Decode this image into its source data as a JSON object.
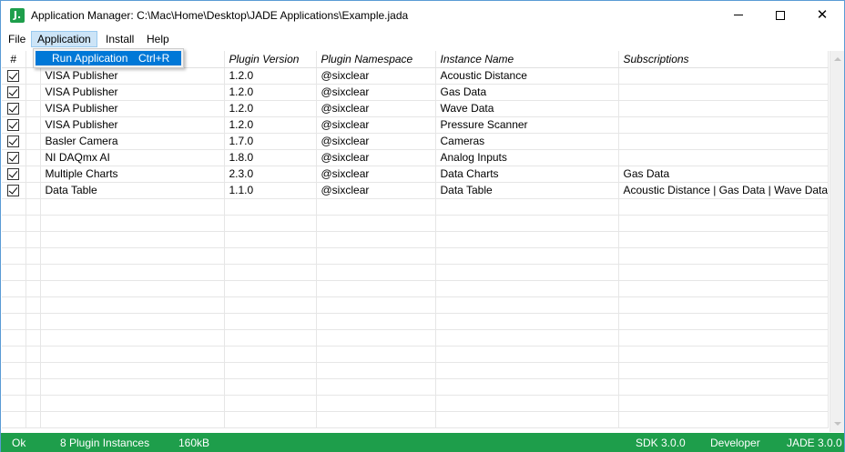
{
  "window": {
    "title": "Application Manager: C:\\Mac\\Home\\Desktop\\JADE Applications\\Example.jada",
    "icon_letter": "J.",
    "controls": {
      "minimize": "minimize-icon",
      "maximize": "maximize-icon",
      "close": "✕"
    }
  },
  "menubar": {
    "items": [
      {
        "label": "File"
      },
      {
        "label": "Application"
      },
      {
        "label": "Install"
      },
      {
        "label": "Help"
      }
    ]
  },
  "dropdown": {
    "item_label": "Run Application",
    "item_shortcut": "Ctrl+R"
  },
  "table": {
    "headers": [
      "#",
      "",
      "",
      "Plugin Version",
      "Plugin Namespace",
      "Instance Name",
      "Subscriptions"
    ],
    "rows": [
      {
        "checked": true,
        "plugin": "VISA Publisher",
        "version": "1.2.0",
        "namespace": "@sixclear",
        "instance": "Acoustic Distance",
        "subscriptions": ""
      },
      {
        "checked": true,
        "plugin": "VISA Publisher",
        "version": "1.2.0",
        "namespace": "@sixclear",
        "instance": "Gas Data",
        "subscriptions": ""
      },
      {
        "checked": true,
        "plugin": "VISA Publisher",
        "version": "1.2.0",
        "namespace": "@sixclear",
        "instance": "Wave Data",
        "subscriptions": ""
      },
      {
        "checked": true,
        "plugin": "VISA Publisher",
        "version": "1.2.0",
        "namespace": "@sixclear",
        "instance": "Pressure Scanner",
        "subscriptions": ""
      },
      {
        "checked": true,
        "plugin": "Basler Camera",
        "version": "1.7.0",
        "namespace": "@sixclear",
        "instance": "Cameras",
        "subscriptions": ""
      },
      {
        "checked": true,
        "plugin": "NI DAQmx AI",
        "version": "1.8.0",
        "namespace": "@sixclear",
        "instance": "Analog Inputs",
        "subscriptions": ""
      },
      {
        "checked": true,
        "plugin": "Multiple Charts",
        "version": "2.3.0",
        "namespace": "@sixclear",
        "instance": "Data Charts",
        "subscriptions": "Gas Data"
      },
      {
        "checked": true,
        "plugin": "Data Table",
        "version": "1.1.0",
        "namespace": "@sixclear",
        "instance": "Data Table",
        "subscriptions": "Acoustic Distance | Gas Data | Wave Data"
      }
    ]
  },
  "statusbar": {
    "status": "Ok",
    "instances": "8 Plugin Instances",
    "size": "160kB",
    "sdk": "SDK 3.0.0",
    "mode": "Developer",
    "version": "JADE 3.0.0"
  },
  "colors": {
    "accent": "#1e9e4b",
    "menu_highlight": "#cce4f7",
    "selection": "#0078d7"
  }
}
